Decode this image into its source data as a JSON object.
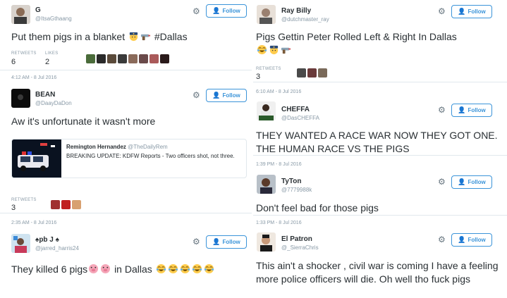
{
  "colors": {
    "accent": "#3b94d9",
    "text": "#292f33",
    "muted": "#8899a6",
    "divider": "#e1e8ed"
  },
  "follow_label": "Follow",
  "stats_labels": {
    "retweets": "RETWEETS",
    "likes": "LIKES"
  },
  "left": {
    "tweet1": {
      "name": "G",
      "handle": "@ItsaGthaang",
      "text": "Put them pigs in a blanket",
      "text_after": "#Dallas",
      "emojis": [
        "police-officer-emoji",
        "pistol-emoji"
      ],
      "retweets": "6",
      "likes": "2",
      "time": "4:12 AM - 8 Jul 2016"
    },
    "tweet2": {
      "name": "BEAN",
      "handle": "@DaayDaDon",
      "text": "Aw it's unfortunate it wasn't more",
      "quote": {
        "name": "Remington Hernandez",
        "handle": "@TheDailyRem",
        "text": "BREAKING UPDATE: KDFW Reports - Two officers shot, not three."
      },
      "retweets": "3",
      "time": "2:35 AM - 8 Jul 2016"
    },
    "tweet3": {
      "name": "♠pb J ♠",
      "handle": "@jarred_harris24",
      "text_before": "They killed 6 pigs",
      "text_mid": "in Dallas",
      "emojis": [
        "pig-face-emoji",
        "pig-face-emoji",
        "laughing-tears-emoji",
        "laughing-tears-emoji",
        "laughing-tears-emoji",
        "laughing-tears-emoji",
        "laughing-tears-emoji"
      ]
    }
  },
  "right": {
    "tweet1": {
      "name": "Ray Billy",
      "handle": "@dutchmaster_ray",
      "text": "Pigs Gettin Peter Rolled Left & Right In Dallas",
      "emojis": [
        "laughing-tears-emoji",
        "police-officer-emoji",
        "pistol-emoji"
      ],
      "retweets": "3",
      "time": "6:10 AM - 8 Jul 2016"
    },
    "tweet2": {
      "name": "CHEFFA",
      "handle": "@DasCHEFFA",
      "text": "THEY WANTED A RACE WAR NOW THEY GOT ONE. THE HUMAN RACE VS THE PIGS",
      "time": "1:39 PM - 8 Jul 2016"
    },
    "tweet3": {
      "name": "TyTon",
      "handle": "@7779988k",
      "text": "Don't feel bad for those pigs",
      "time": "1:33 PM - 8 Jul 2016"
    },
    "tweet4": {
      "name": "El Patron",
      "handle": "@_SierraChris",
      "text": "This ain't a shocker , civil war is coming I have a feeling more police officers will die. Oh well tho fuck pigs"
    }
  }
}
